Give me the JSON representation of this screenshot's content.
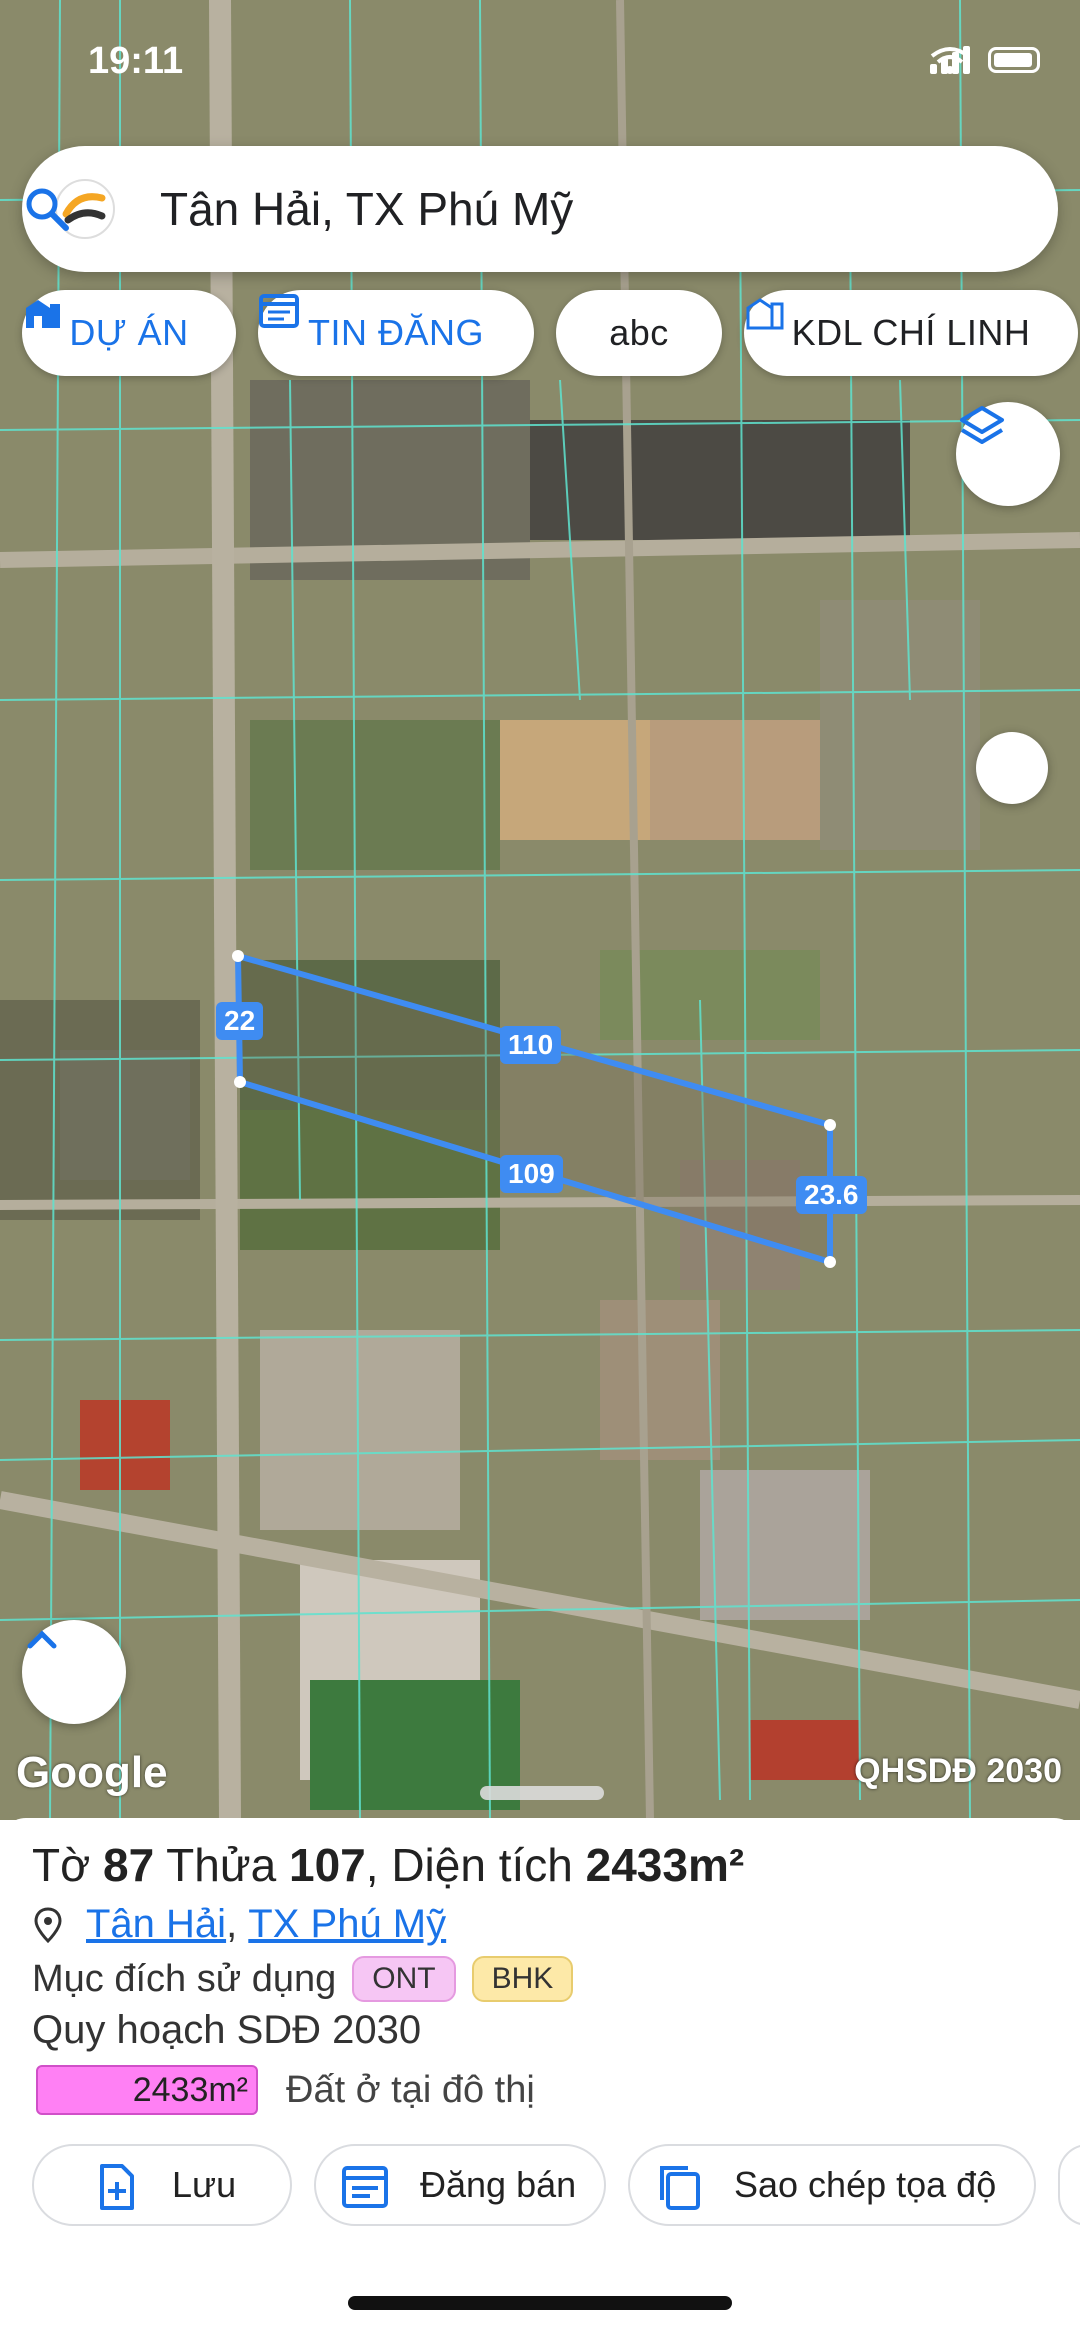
{
  "status_bar": {
    "time": "19:11"
  },
  "search": {
    "query": "Tân Hải, TX Phú Mỹ"
  },
  "chips": {
    "du_an": "DỰ ÁN",
    "tin_dang": "TIN ĐĂNG",
    "abc": "abc",
    "kdl": "KDL CHÍ LINH"
  },
  "map": {
    "attribution": "Google",
    "layer_label": "QHSDĐ 2030",
    "dimensions": {
      "left": "22",
      "top": "110",
      "bottom": "109",
      "right": "23.6"
    }
  },
  "parcel": {
    "to_label": "Tờ",
    "to_value": "87",
    "thua_label": "Thửa",
    "thua_value": "107",
    "area_label": "Diện tích",
    "area_value": "2433m²",
    "ward": "Tân Hải",
    "town": "TX Phú Mỹ",
    "purpose_label": "Mục đích sử dụng",
    "purpose_tags": [
      "ONT",
      "BHK"
    ],
    "plan_label": "Quy hoạch SDĐ 2030",
    "plan_area": "2433m²",
    "plan_desc": "Đất ở tại đô thị"
  },
  "actions": {
    "save": "Lưu",
    "post_sale": "Đăng bán",
    "copy_coords": "Sao chép tọa độ"
  },
  "colors": {
    "accent": "#1a73e8",
    "parcel_outline": "#3f8cf2",
    "plan_fill": "#ff80f4",
    "ont_tag": "#f6c6f4",
    "bhk_tag": "#fde9a8"
  }
}
